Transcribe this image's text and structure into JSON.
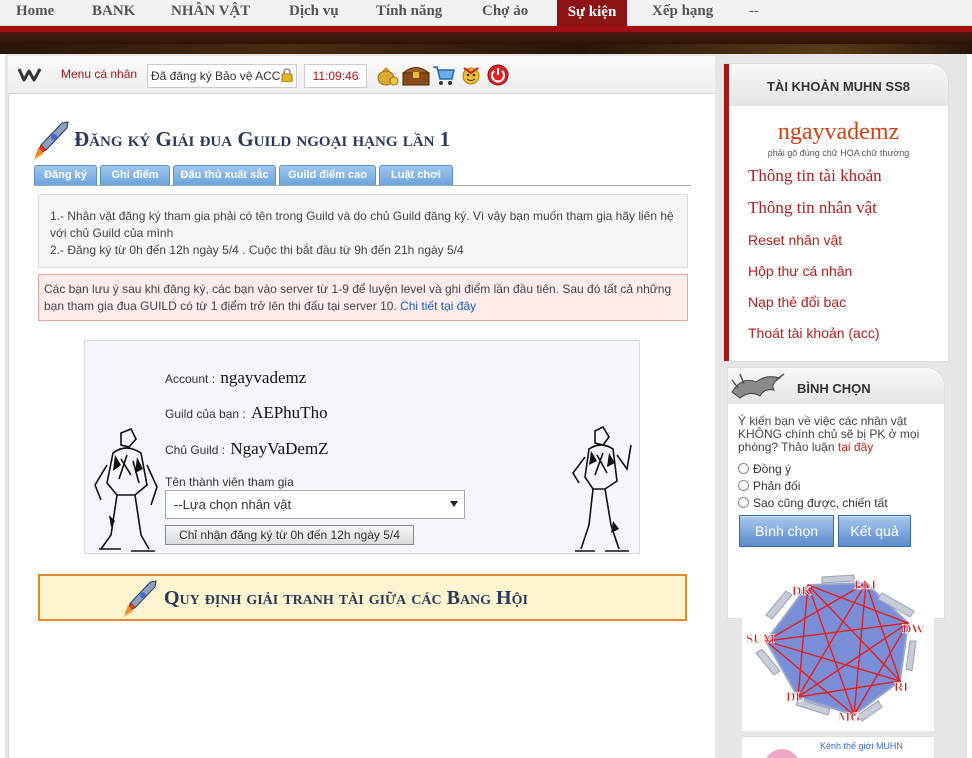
{
  "topnav": {
    "items": [
      "Home",
      "BANK",
      "NHÂN VẬT",
      "Dịch vụ",
      "Tính năng",
      "Chợ ảo",
      "Sự kiện",
      "Xếp hạng",
      "--"
    ],
    "active": "Sự kiện"
  },
  "toolbar": {
    "menu_label": "Menu cá nhân",
    "protect_label": "Đã đăng ký Bảo vệ ACC",
    "clock": "11:09:46",
    "icons": [
      "money-bag-icon",
      "treasure-chest-icon",
      "shopping-cart-icon",
      "gift-icon",
      "power-icon"
    ]
  },
  "page": {
    "title": "Đăng ký Giải đua Guild ngoại hạng lần 1",
    "tabs": [
      "Đăng ký",
      "Ghi điểm",
      "Đấu thủ xuất sắc",
      "Guild điểm cao",
      "Luật chơi"
    ],
    "info_lines": [
      "1.- Nhân vật đăng ký tham gia phải có tên trong Guild và do chủ Guild đăng ký. Vì vậy bạn muốn tham gia hãy liên hệ với chủ Guild của mình",
      "2.- Đăng ký từ 0h đến 12h ngày 5/4 . Cuộc thi bắt đầu từ 9h đến 21h ngày 5/4"
    ],
    "notice_text": "Các bạn lưu ý sau khi đăng ký, các bạn vào server từ 1-9 để luyện level và ghi điểm lần đầu tiên. Sau đó tất cả những bạn tham gia đua GUILD có từ 1 điểm trở lên thi đấu tại server 10.",
    "notice_link": "Chi tiết tại đây",
    "rules_title": "Quy định giải tranh tài giữa các Bang Hội"
  },
  "form": {
    "account_label": "Account :",
    "account_value": "ngayvademz",
    "guild_label": "Guild của bạn :",
    "guild_value": "AEPhuTho",
    "owner_label": "Chủ Guild :",
    "owner_value": "NgayVaDemZ",
    "member_label": "Tên thành viên tham gia",
    "select_value": "--Lựa chọn nhân vật",
    "submit_label": "Chỉ nhận đăng ký từ 0h đến 12h ngày 5/4"
  },
  "sidebar": {
    "account_title": "TÀI KHOẢN MUHN SS8",
    "username": "ngayvademz",
    "username_note": "phải gõ đúng chữ HOA chữ thường",
    "links_big": [
      "Thông tin tài khoản",
      "Thông tin nhân vật"
    ],
    "links_small": [
      "Reset nhân vật",
      "Hộp thư cá nhân",
      "Nạp thẻ đổi bạc",
      "Thoát tài khoản (acc)"
    ],
    "vote_title": "BÌNH CHỌN",
    "vote_question": "Ý kiến bạn về việc các nhân vật KHÔNG chính chủ sẽ bị PK ở mọi phòng? Thảo luận",
    "vote_link": "tại đây",
    "vote_options": [
      "Đồng ý",
      "Phản đối",
      "Sao cũng được, chiến tất"
    ],
    "vote_button": "Bình chọn",
    "result_button": "Kết quả",
    "diagram_labels": [
      "DK",
      "ELF",
      "DW",
      "RF",
      "MG",
      "DL",
      "SUM"
    ],
    "bottom_text": "Kênh thế giới MUHN"
  },
  "colors": {
    "accent_red": "#8c1414",
    "link_red": "#b81c1c",
    "tab_blue": "#6aa2da",
    "title_navy": "#2a3a5a"
  }
}
